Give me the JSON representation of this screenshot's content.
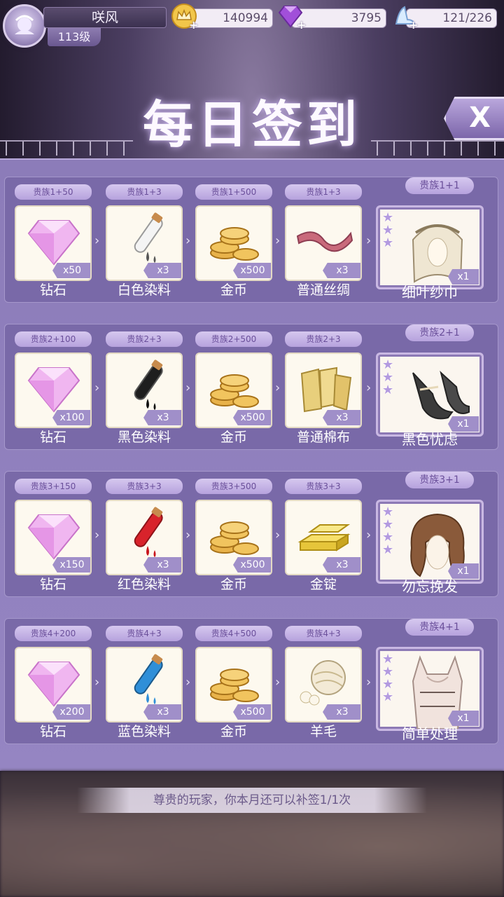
{
  "player": {
    "name": "咲风",
    "level": "113级"
  },
  "resources": {
    "gold": "140994",
    "diamond": "3795",
    "stamina": "121/226"
  },
  "page_title": "每日签到",
  "close_label": "X",
  "rows": [
    {
      "items": [
        {
          "tier": "贵族1+50",
          "count": "x50",
          "name": "钻石",
          "icon": "diamond-icon"
        },
        {
          "tier": "贵族1+3",
          "count": "x3",
          "name": "白色染料",
          "icon": "white-dye-icon"
        },
        {
          "tier": "贵族1+500",
          "count": "x500",
          "name": "金币",
          "icon": "gold-coins-icon"
        },
        {
          "tier": "贵族1+3",
          "count": "x3",
          "name": "普通丝绸",
          "icon": "silk-icon"
        }
      ],
      "final": {
        "tier": "贵族1+1",
        "count": "x1",
        "name": "细叶纱巾",
        "stars": 3
      }
    },
    {
      "items": [
        {
          "tier": "贵族2+100",
          "count": "x100",
          "name": "钻石",
          "icon": "diamond-icon"
        },
        {
          "tier": "贵族2+3",
          "count": "x3",
          "name": "黑色染料",
          "icon": "black-dye-icon"
        },
        {
          "tier": "贵族2+500",
          "count": "x500",
          "name": "金币",
          "icon": "gold-coins-icon"
        },
        {
          "tier": "贵族2+3",
          "count": "x3",
          "name": "普通棉布",
          "icon": "cotton-icon"
        }
      ],
      "final": {
        "tier": "贵族2+1",
        "count": "x1",
        "name": "黑色忧虑",
        "stars": 3
      }
    },
    {
      "items": [
        {
          "tier": "贵族3+150",
          "count": "x150",
          "name": "钻石",
          "icon": "diamond-icon"
        },
        {
          "tier": "贵族3+3",
          "count": "x3",
          "name": "红色染料",
          "icon": "red-dye-icon"
        },
        {
          "tier": "贵族3+500",
          "count": "x500",
          "name": "金币",
          "icon": "gold-coins-icon"
        },
        {
          "tier": "贵族3+3",
          "count": "x3",
          "name": "金锭",
          "icon": "gold-ingot-icon"
        }
      ],
      "final": {
        "tier": "贵族3+1",
        "count": "x1",
        "name": "勿忘挽发",
        "stars": 4
      }
    },
    {
      "items": [
        {
          "tier": "贵族4+200",
          "count": "x200",
          "name": "钻石",
          "icon": "diamond-icon"
        },
        {
          "tier": "贵族4+3",
          "count": "x3",
          "name": "蓝色染料",
          "icon": "blue-dye-icon"
        },
        {
          "tier": "贵族4+500",
          "count": "x500",
          "name": "金币",
          "icon": "gold-coins-icon"
        },
        {
          "tier": "贵族4+3",
          "count": "x3",
          "name": "羊毛",
          "icon": "wool-icon"
        }
      ],
      "final": {
        "tier": "贵族4+1",
        "count": "x1",
        "name": "简单处理",
        "stars": 4
      }
    }
  ],
  "footer_message": "尊贵的玩家，你本月还可以补签1/1次",
  "colors": {
    "panel": "#8c7cb9",
    "row": "#7969a8",
    "tag": "#a08fc9",
    "accent": "#b6a2dd"
  }
}
